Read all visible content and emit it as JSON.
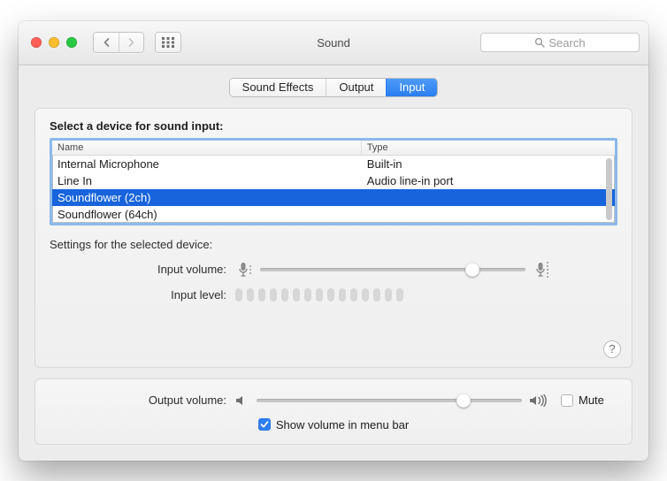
{
  "window": {
    "title": "Sound"
  },
  "toolbar": {
    "search_placeholder": "Search"
  },
  "tabs": [
    {
      "label": "Sound Effects",
      "active": false
    },
    {
      "label": "Output",
      "active": false
    },
    {
      "label": "Input",
      "active": true
    }
  ],
  "main": {
    "heading": "Select a device for sound input:",
    "columns": {
      "name": "Name",
      "type": "Type"
    },
    "devices": [
      {
        "name": "Internal Microphone",
        "type": "Built-in",
        "selected": false
      },
      {
        "name": "Line In",
        "type": "Audio line-in port",
        "selected": false
      },
      {
        "name": "Soundflower (2ch)",
        "type": "",
        "selected": true
      },
      {
        "name": "Soundflower (64ch)",
        "type": "",
        "selected": false
      }
    ],
    "settings_heading": "Settings for the selected device:",
    "input_volume_label": "Input volume:",
    "input_volume_percent": 80,
    "input_level_label": "Input level:",
    "input_level_segments": 15,
    "help_tooltip": "?"
  },
  "footer": {
    "output_volume_label": "Output volume:",
    "output_volume_percent": 78,
    "mute_label": "Mute",
    "mute_checked": false,
    "show_in_menubar_label": "Show volume in menu bar",
    "show_in_menubar_checked": true
  }
}
